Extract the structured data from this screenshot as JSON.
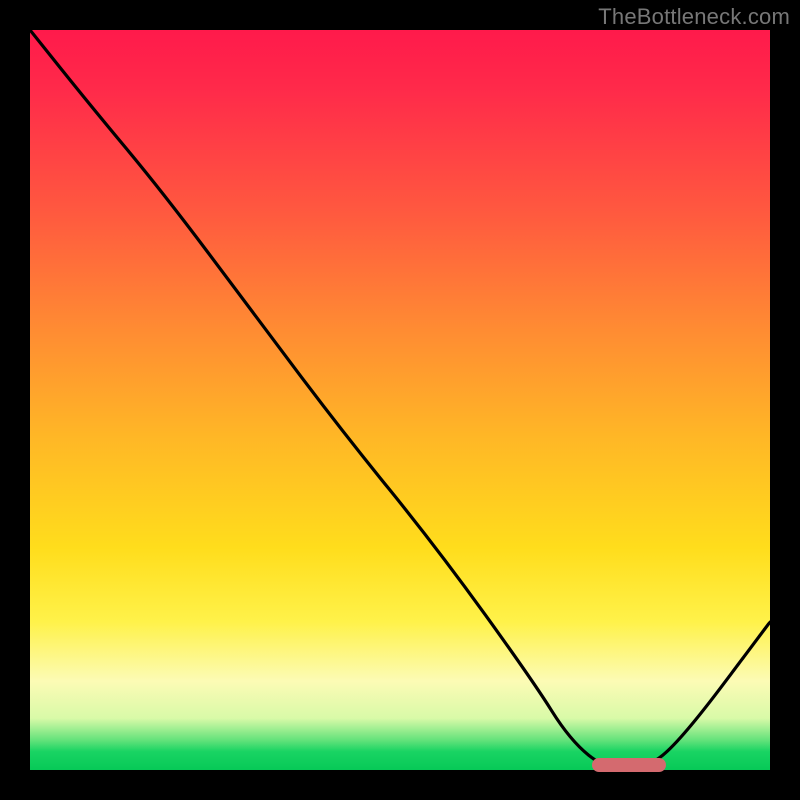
{
  "watermark": "TheBottleneck.com",
  "colors": {
    "curve": "#000000",
    "marker": "#d46a6f",
    "frame_bg": "#000000"
  },
  "chart_data": {
    "type": "line",
    "title": "",
    "xlabel": "",
    "ylabel": "",
    "xlim": [
      0,
      100
    ],
    "ylim": [
      0,
      100
    ],
    "grid": false,
    "legend": false,
    "series": [
      {
        "name": "bottleneck-curve",
        "x": [
          0,
          8,
          18,
          30,
          42,
          55,
          68,
          73,
          78,
          83,
          88,
          100
        ],
        "values": [
          100,
          90,
          78,
          62,
          46,
          30,
          12,
          4,
          0,
          0,
          4,
          20
        ]
      }
    ],
    "marker": {
      "x_start": 76,
      "x_end": 86,
      "y": 0
    },
    "gradient_stops": [
      {
        "pct": 0,
        "color": "#ff1a4b"
      },
      {
        "pct": 25,
        "color": "#ff5a3f"
      },
      {
        "pct": 55,
        "color": "#ffb726"
      },
      {
        "pct": 80,
        "color": "#fff24a"
      },
      {
        "pct": 97,
        "color": "#19d463"
      },
      {
        "pct": 100,
        "color": "#07c957"
      }
    ]
  }
}
